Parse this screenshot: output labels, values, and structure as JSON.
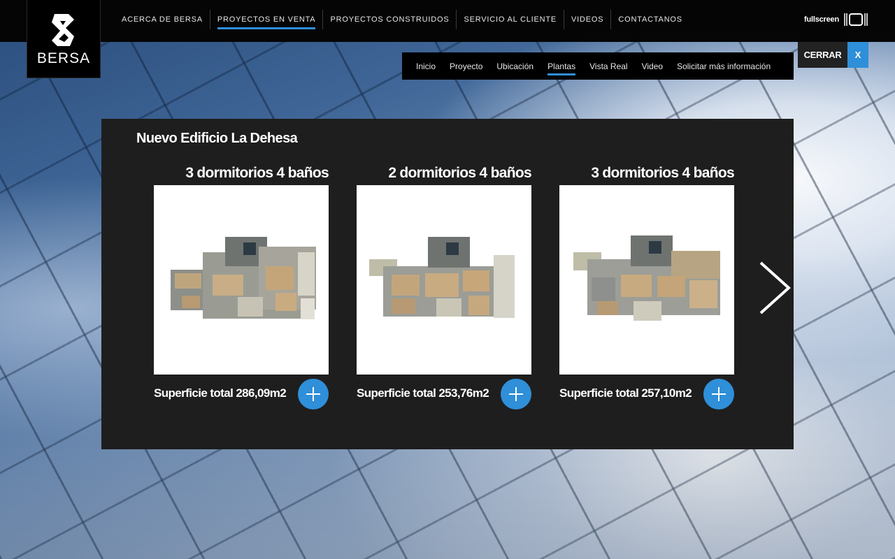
{
  "brand": {
    "name": "BERSA"
  },
  "main_nav": [
    {
      "label": "ACERCA DE BERSA",
      "active": false
    },
    {
      "label": "PROYECTOS EN VENTA",
      "active": true
    },
    {
      "label": "PROYECTOS CONSTRUIDOS",
      "active": false
    },
    {
      "label": "SERVICIO AL CLIENTE",
      "active": false
    },
    {
      "label": "VIDEOS",
      "active": false
    },
    {
      "label": "CONTACTANOS",
      "active": false
    }
  ],
  "fullscreen": {
    "label": "fullscreen"
  },
  "sub_nav": [
    {
      "label": "Inicio",
      "active": false
    },
    {
      "label": "Proyecto",
      "active": false
    },
    {
      "label": "Ubicación",
      "active": false
    },
    {
      "label": "Plantas",
      "active": true
    },
    {
      "label": "Vista Real",
      "active": false
    },
    {
      "label": "Video",
      "active": false
    },
    {
      "label": "Solicitar más información",
      "active": false
    }
  ],
  "close": {
    "label": "CERRAR",
    "x_label": "X"
  },
  "panel": {
    "title": "Nuevo Edificio La Dehesa",
    "plans": [
      {
        "heading": "3 dormitorios 4 baños",
        "area": "Superficie total 286,09m2"
      },
      {
        "heading": "2 dormitorios 4 baños",
        "area": "Superficie total 253,76m2"
      },
      {
        "heading": "3 dormitorios 4 baños",
        "area": "Superficie total 257,10m2"
      }
    ]
  },
  "colors": {
    "accent": "#2f8fd9",
    "panel": "#1e1e1e",
    "topbar": "#050505"
  },
  "icons": {
    "next": "chevron-right-icon",
    "plus": "plus-icon",
    "fullscreen": "fullscreen-icon"
  }
}
